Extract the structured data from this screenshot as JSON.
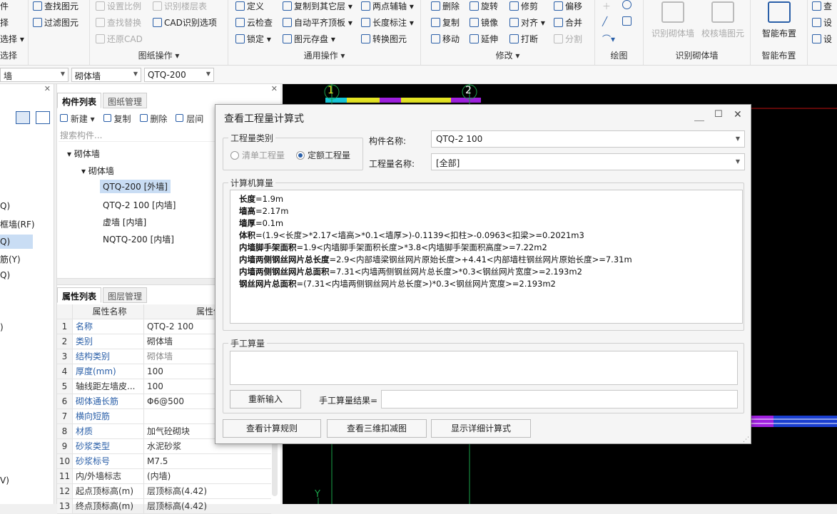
{
  "ribbon": {
    "col1": [
      "件",
      "择",
      "选择 ▾"
    ],
    "col1_title": "选择",
    "col2": [
      "查找图元",
      "过滤图元"
    ],
    "col3": [
      "设置比例",
      "查找替换",
      "还原CAD"
    ],
    "col4": [
      "识别楼层表",
      "CAD识别选项"
    ],
    "group_drawing_ops": "图纸操作 ▾",
    "col5": [
      "定义",
      "云检查",
      "锁定 ▾"
    ],
    "col6": [
      "复制到其它层 ▾",
      "自动平齐顶板 ▾",
      "图元存盘 ▾"
    ],
    "col7": [
      "两点辅轴 ▾",
      "长度标注 ▾",
      "转换图元"
    ],
    "group_common_ops": "通用操作 ▾",
    "col8": [
      "删除",
      "复制",
      "移动"
    ],
    "col9": [
      "旋转",
      "镜像",
      "延伸"
    ],
    "col10": [
      "修剪",
      "对齐 ▾",
      "打断"
    ],
    "col11": [
      "偏移",
      "合并",
      "分割"
    ],
    "group_modify": "修改 ▾",
    "group_draw": "绘图",
    "big_btn1": "识别砌体墙",
    "big_btn2": "校核墙图元",
    "group_recognize": "识别砌体墙",
    "big_btn3": "智能布置",
    "group_smart": "智能布置",
    "col12": [
      "查",
      "设",
      "设"
    ]
  },
  "toolbar2": {
    "combo1": "墙",
    "combo2": "砌体墙",
    "combo3": "QTQ-200"
  },
  "leftstrip": {
    "items": [
      "Q)",
      "框墙(RF)",
      "Q)",
      "筋(Y)",
      "Q)",
      ")",
      "V)"
    ]
  },
  "comp_panel": {
    "tab_active": "构件列表",
    "tab_other": "图纸管理",
    "new_btn": "新建",
    "copy_btn": "复制",
    "delete_btn": "删除",
    "layer_btn": "层间",
    "search_placeholder": "搜索构件...",
    "tree": {
      "root": "砌体墙",
      "child": "砌体墙",
      "leaves": [
        "QTQ-200 [外墙]",
        "QTQ-2  100 [内墙]",
        "虚墙 [内墙]",
        "NQTQ-200 [内墙]"
      ]
    }
  },
  "prop_panel": {
    "tab_active": "属性列表",
    "tab_other": "图层管理",
    "col_name": "属性名称",
    "col_value": "属性值",
    "rows": [
      {
        "n": "1",
        "k": "名称",
        "v": "QTQ-2  100"
      },
      {
        "n": "2",
        "k": "类别",
        "v": "砌体墙"
      },
      {
        "n": "3",
        "k": "结构类别",
        "v": "砌体墙"
      },
      {
        "n": "4",
        "k": "厚度(mm)",
        "v": "100"
      },
      {
        "n": "5",
        "k": "轴线距左墙皮...",
        "v": "100"
      },
      {
        "n": "6",
        "k": "砌体通长筋",
        "v": "Φ6@500"
      },
      {
        "n": "7",
        "k": "横向短筋",
        "v": ""
      },
      {
        "n": "8",
        "k": "材质",
        "v": "加气砼砌块"
      },
      {
        "n": "9",
        "k": "砂浆类型",
        "v": "水泥砂浆"
      },
      {
        "n": "10",
        "k": "砂浆标号",
        "v": "M7.5"
      },
      {
        "n": "11",
        "k": "内/外墙标志",
        "v": "(内墙)"
      },
      {
        "n": "12",
        "k": "起点顶标高(m)",
        "v": "层顶标高(4.42)"
      },
      {
        "n": "13",
        "k": "终点顶标高(m)",
        "v": "层顶标高(4.42)"
      }
    ]
  },
  "canvas": {
    "axis1": "1",
    "axis2": "2",
    "y_label": "Y"
  },
  "dialog": {
    "title": "查看工程量计算式",
    "qty_type_legend": "工程量类别",
    "radio1": "清单工程量",
    "radio2": "定额工程量",
    "comp_name_label": "构件名称:",
    "comp_name_value": "QTQ-2  100",
    "qty_name_label": "工程量名称:",
    "qty_name_value": "[全部]",
    "calc_legend": "计算机算量",
    "calc_lines": [
      {
        "b": "长度",
        "t": "=1.9m"
      },
      {
        "b": "墙高",
        "t": "=2.17m"
      },
      {
        "b": "墙厚",
        "t": "=0.1m"
      },
      {
        "b": "体积",
        "t": "=(1.9<长度>*2.17<墙高>*0.1<墙厚>)-0.1139<扣柱>-0.0963<扣梁>=0.2021m3"
      },
      {
        "b": "内墙脚手架面积",
        "t": "=1.9<内墙脚手架面积长度>*3.8<内墙脚手架面积高度>=7.22m2"
      },
      {
        "b": "内墙两侧钢丝网片总长度",
        "t": "=2.9<内部墙梁钢丝网片原始长度>+4.41<内部墙柱钢丝网片原始长度>=7.31m"
      },
      {
        "b": "内墙两侧钢丝网片总面积",
        "t": "=7.31<内墙两侧钢丝网片总长度>*0.3<钢丝网片宽度>=2.193m2"
      },
      {
        "b": "钢丝网片总面积",
        "t": "=(7.31<内墙两侧钢丝网片总长度>)*0.3<钢丝网片宽度>=2.193m2"
      }
    ],
    "manual_legend": "手工算量",
    "reinput_btn": "重新输入",
    "manual_result_label": "手工算量结果=",
    "manual_result_value": "",
    "btn_rules": "查看计算规则",
    "btn_3d": "查看三维扣减图",
    "btn_detail": "显示详细计算式"
  }
}
